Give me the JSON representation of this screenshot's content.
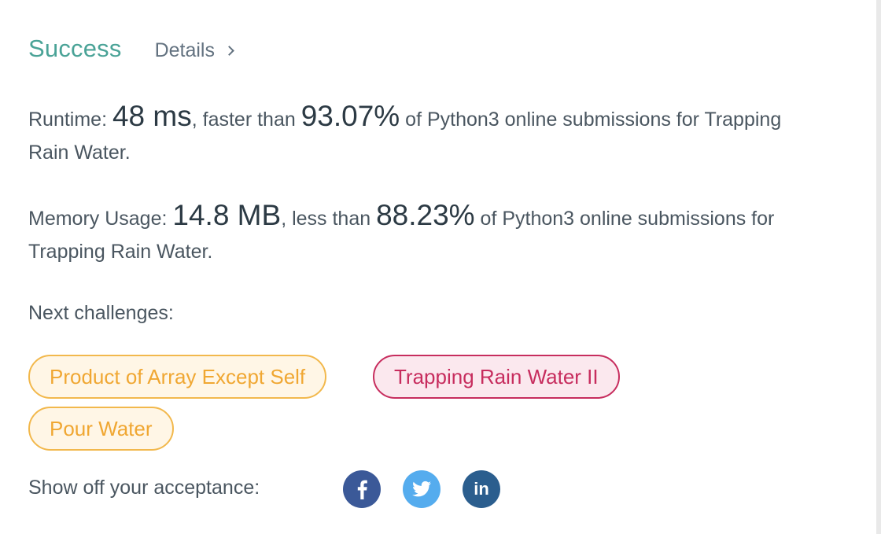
{
  "header": {
    "status": "Success",
    "details_label": "Details"
  },
  "runtime": {
    "label": "Runtime: ",
    "value": "48 ms",
    "middle": ", faster than ",
    "percent": "93.07%",
    "suffix": " of Python3 online submissions for Trapping Rain Water."
  },
  "memory": {
    "label": "Memory Usage: ",
    "value": "14.8 MB",
    "middle": ", less than ",
    "percent": "88.23%",
    "suffix": " of Python3 online submissions for Trapping Rain Water."
  },
  "next": {
    "label": "Next challenges:",
    "challenges": [
      {
        "title": "Product of Array Except Self",
        "difficulty": "medium"
      },
      {
        "title": "Trapping Rain Water II",
        "difficulty": "hard"
      },
      {
        "title": "Pour Water",
        "difficulty": "medium"
      }
    ]
  },
  "share": {
    "label": "Show off your acceptance:",
    "icons": [
      "facebook-icon",
      "twitter-icon",
      "linkedin-icon"
    ],
    "linkedin_text": "in"
  },
  "colors": {
    "success": "#4aa397",
    "medium": "#f0a732",
    "hard": "#c72d5e",
    "facebook": "#3b5998",
    "twitter": "#55acee",
    "linkedin": "#2b5e8e"
  }
}
